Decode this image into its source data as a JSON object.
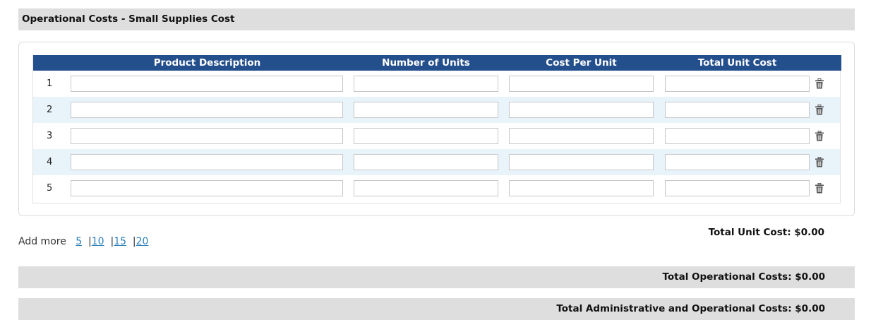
{
  "section": {
    "title": "Operational Costs - Small Supplies Cost"
  },
  "table": {
    "columns": [
      "Product Description",
      "Number of Units",
      "Cost Per Unit",
      "Total Unit Cost"
    ],
    "rows": [
      {
        "number": "1",
        "description": "",
        "units": "",
        "cost_per_unit": "",
        "total_unit_cost": ""
      },
      {
        "number": "2",
        "description": "",
        "units": "",
        "cost_per_unit": "",
        "total_unit_cost": ""
      },
      {
        "number": "3",
        "description": "",
        "units": "",
        "cost_per_unit": "",
        "total_unit_cost": ""
      },
      {
        "number": "4",
        "description": "",
        "units": "",
        "cost_per_unit": "",
        "total_unit_cost": ""
      },
      {
        "number": "5",
        "description": "",
        "units": "",
        "cost_per_unit": "",
        "total_unit_cost": ""
      }
    ],
    "row_action_icon": "trash-icon",
    "header_color": "#244f8d",
    "alt_row_color": "#e8f3fa"
  },
  "add_more": {
    "label": "Add more",
    "options": [
      "5",
      "10",
      "15",
      "20"
    ],
    "separator": "|"
  },
  "totals": {
    "total_unit_cost": "Total Unit Cost: $0.00",
    "total_operational_costs": "Total Operational Costs: $0.00",
    "total_admin_operational_costs": "Total Administrative and Operational Costs: $0.00"
  }
}
